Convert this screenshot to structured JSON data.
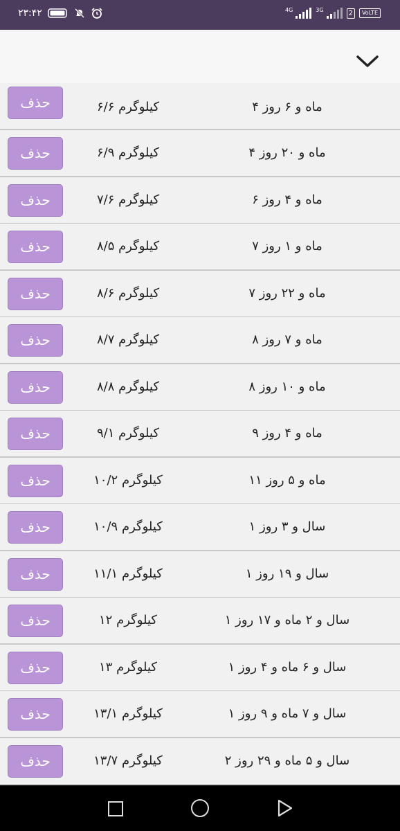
{
  "status_bar": {
    "time": "۲۳:۴۲",
    "network_1": "4G",
    "network_2": "3G",
    "sim": "2",
    "volte": "VoLTE",
    "icons": [
      "battery-icon",
      "mute-icon",
      "alarm-icon",
      "signal-icon"
    ]
  },
  "toolbar": {
    "icon": "chevron-down-icon"
  },
  "rows": [
    {
      "age": "۴ ماه و ۶ روز",
      "weight": "۶/۶ کیلوگرم",
      "delete": "حذف"
    },
    {
      "age": "۴ ماه و ۲۰ روز",
      "weight": "۶/۹ کیلوگرم",
      "delete": "حذف"
    },
    {
      "age": "۶ ماه و ۴ روز",
      "weight": "۷/۶ کیلوگرم",
      "delete": "حذف"
    },
    {
      "age": "۷ ماه و ۱ روز",
      "weight": "۸/۵ کیلوگرم",
      "delete": "حذف"
    },
    {
      "age": "۷ ماه و ۲۲ روز",
      "weight": "۸/۶ کیلوگرم",
      "delete": "حذف"
    },
    {
      "age": "۸ ماه و ۷ روز",
      "weight": "۸/۷ کیلوگرم",
      "delete": "حذف"
    },
    {
      "age": "۸ ماه و ۱۰ روز",
      "weight": "۸/۸ کیلوگرم",
      "delete": "حذف"
    },
    {
      "age": "۹ ماه و ۴ روز",
      "weight": "۹/۱ کیلوگرم",
      "delete": "حذف"
    },
    {
      "age": "۱۱ ماه و ۵ روز",
      "weight": "۱۰/۲ کیلوگرم",
      "delete": "حذف"
    },
    {
      "age": "۱ سال و ۳ روز",
      "weight": "۱۰/۹ کیلوگرم",
      "delete": "حذف"
    },
    {
      "age": "۱ سال و ۱۹ روز",
      "weight": "۱۱/۱ کیلوگرم",
      "delete": "حذف"
    },
    {
      "age": "۱ سال و ۲ ماه و ۱۷ روز",
      "weight": "۱۲ کیلوگرم",
      "delete": "حذف"
    },
    {
      "age": "۱ سال و ۶ ماه و ۴ روز",
      "weight": "۱۳ کیلوگرم",
      "delete": "حذف"
    },
    {
      "age": "۱ سال و ۷ ماه و ۹ روز",
      "weight": "۱۳/۱ کیلوگرم",
      "delete": "حذف"
    },
    {
      "age": "۲ سال و ۵ ماه و ۲۹ روز",
      "weight": "۱۳/۷ کیلوگرم",
      "delete": "حذف"
    }
  ],
  "nav": {
    "icons": [
      "recents-icon",
      "home-icon",
      "back-icon"
    ]
  }
}
